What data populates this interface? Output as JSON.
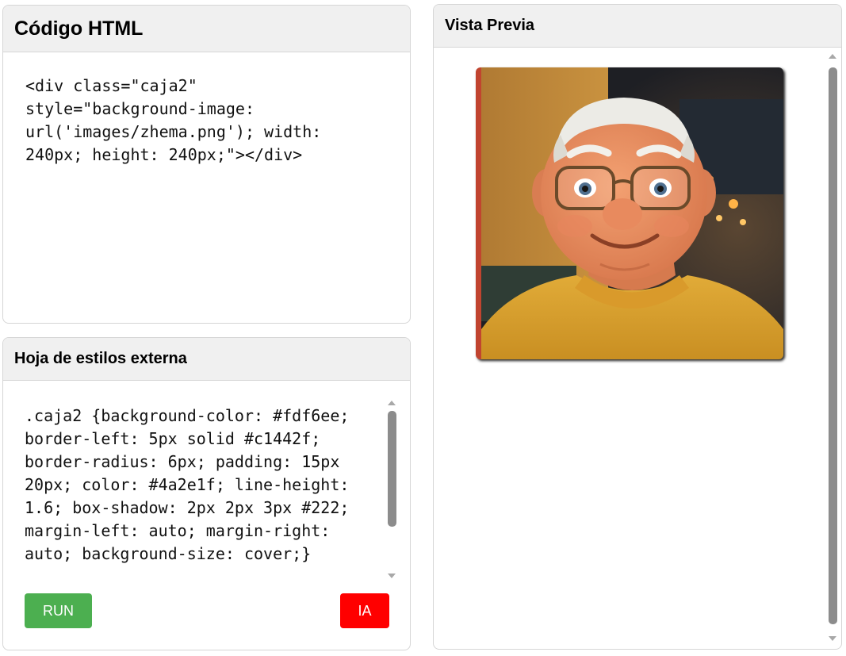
{
  "html_panel": {
    "title": "Código HTML",
    "code": "<div class=\"caja2\" style=\"background-image: url('images/zhema.png'); width: 240px; height: 240px;\"></div>"
  },
  "css_panel": {
    "title": "Hoja de estilos externa",
    "code": ".caja2 {background-color: #fdf6ee; border-left: 5px solid #c1442f; border-radius: 6px; padding: 15px 20px; color: #4a2e1f; line-height: 1.6; box-shadow: 2px 2px 3px #222; margin-left: auto; margin-right: auto; background-size: cover;}",
    "run_label": "RUN",
    "ia_label": "IA"
  },
  "preview_panel": {
    "title": "Vista Previa",
    "image_description_icon": "cartoon-elderly-man-portrait"
  },
  "colors": {
    "run_button": "#4caf50",
    "ia_button": "#ff0000",
    "box_border_left": "#c1442f",
    "box_background": "#fdf6ee"
  }
}
